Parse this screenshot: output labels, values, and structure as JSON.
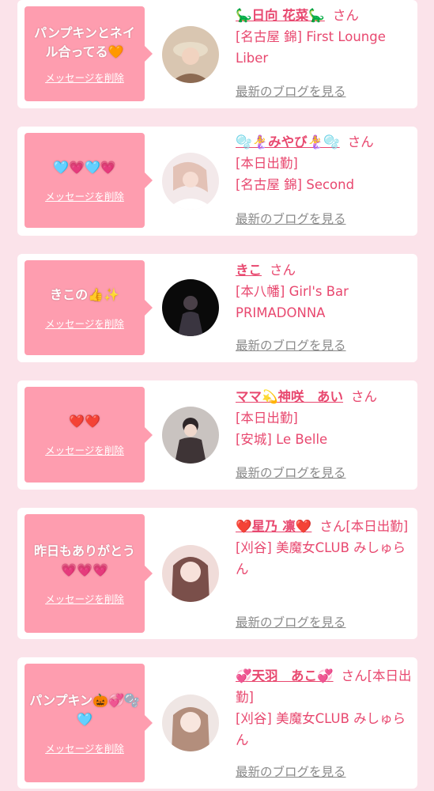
{
  "cards": [
    {
      "message": "パンプキンとネイル合ってる🧡",
      "delete_label": "メッセージを削除",
      "name": "🦕日向 花菜🦕",
      "san": "さん",
      "shop_lines": [
        "[名古屋 錦] First Lounge Liber"
      ],
      "blog_label": "最新のブログを見る",
      "avatar_colors": [
        "#d9c6b1",
        "#8c6a52"
      ]
    },
    {
      "message": "🩵💗🩵💗",
      "delete_label": "メッセージを削除",
      "name": "🫧🧜‍♀️みやび🧜‍♀️🫧",
      "san": "さん",
      "shop_lines": [
        "[本日出勤]",
        "[名古屋 錦] Second"
      ],
      "blog_label": "最新のブログを見る",
      "avatar_colors": [
        "#f3e9ea",
        "#d8b9b5"
      ]
    },
    {
      "message": "きこの👍✨",
      "delete_label": "メッセージを削除",
      "name": "きこ",
      "san": "さん",
      "shop_lines": [
        "[本八幡] Girl's Bar PRIMADONNA"
      ],
      "blog_label": "最新のブログを見る",
      "avatar_colors": [
        "#0a0a0a",
        "#3a3540"
      ]
    },
    {
      "message": "❤️❤️",
      "delete_label": "メッセージを削除",
      "name": "ママ💫神咲　あい",
      "san": "さん",
      "shop_lines": [
        "[本日出勤]",
        "[安城] Le Belle"
      ],
      "blog_label": "最新のブログを見る",
      "avatar_colors": [
        "#c9c3c0",
        "#3e3436"
      ]
    },
    {
      "message": "昨日もありがとう💗💗💗",
      "delete_label": "メッセージを削除",
      "name": "❤️星乃 凛❤️",
      "san": "さん[本日出勤]",
      "shop_lines": [
        "[刈谷] 美魔女CLUB みしゅらん"
      ],
      "blog_label": "最新のブログを見る",
      "avatar_colors": [
        "#f0dcd9",
        "#7a4f4a"
      ]
    },
    {
      "message": "パンプキン🎃💞🫧🩵",
      "delete_label": "メッセージを削除",
      "name": "💞天羽　あこ💞",
      "san": "さん[本日出勤]",
      "shop_lines": [
        "[刈谷] 美魔女CLUB みしゅらん"
      ],
      "blog_label": "最新のブログを見る",
      "avatar_colors": [
        "#efe6e4",
        "#b38e7c"
      ]
    }
  ]
}
